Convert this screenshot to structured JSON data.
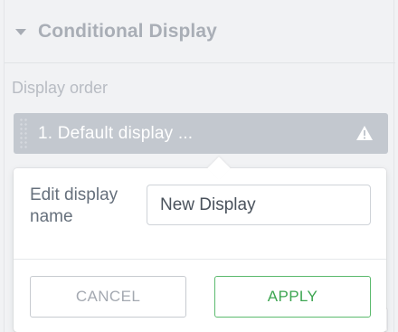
{
  "section": {
    "title": "Conditional Display",
    "caret_icon": "caret-down-icon"
  },
  "display_order": {
    "label": "Display order",
    "items": [
      {
        "label": "1. Default display ...",
        "status_icon": "warning-icon"
      }
    ]
  },
  "popover": {
    "field_label": "Edit display name",
    "input_value": "New Display",
    "cancel_label": "CANCEL",
    "apply_label": "APPLY"
  },
  "colors": {
    "apply_accent": "#3ea652",
    "row_background": "#c3c8cf"
  }
}
